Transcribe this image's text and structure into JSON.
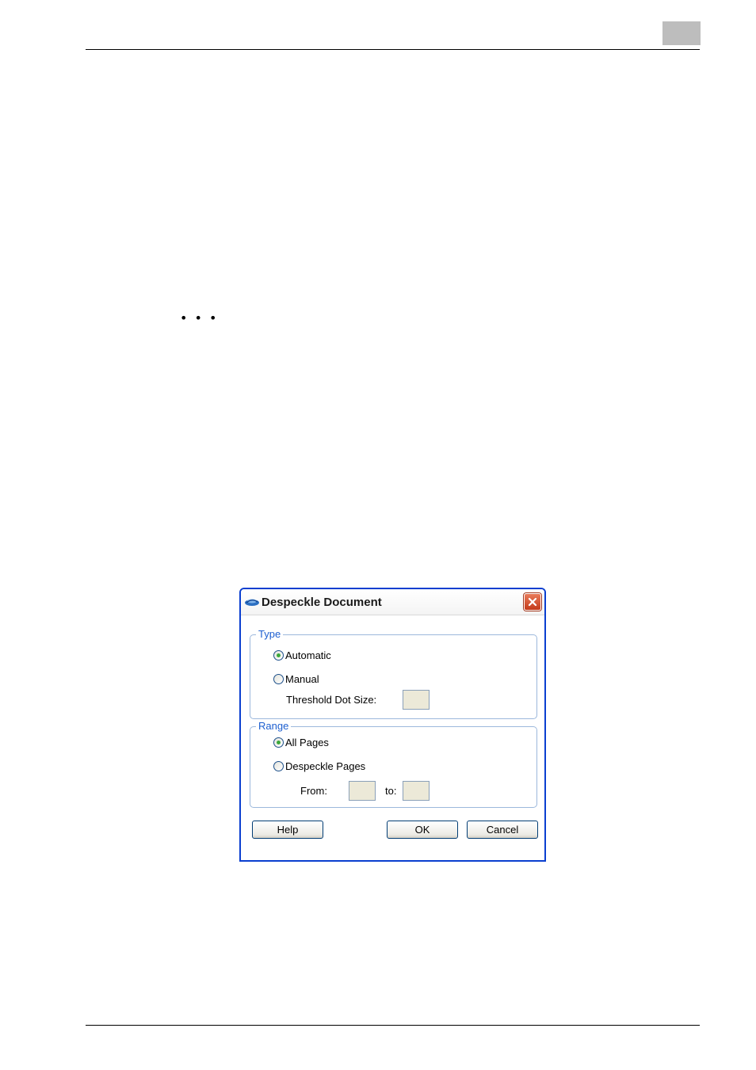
{
  "page": {
    "ellipsis": "• • •"
  },
  "dialog": {
    "title": "Despeckle Document",
    "close_icon": "close-icon",
    "app_icon": "despeckle-app-icon",
    "type_group": {
      "title": "Type",
      "options": [
        {
          "label": "Automatic",
          "checked": true
        },
        {
          "label": "Manual",
          "checked": false
        }
      ],
      "threshold_label": "Threshold Dot Size:",
      "threshold_value": ""
    },
    "range_group": {
      "title": "Range",
      "options": [
        {
          "label": "All Pages",
          "checked": true
        },
        {
          "label": "Despeckle Pages",
          "checked": false
        }
      ],
      "from_label": "From:",
      "from_value": "",
      "to_label": "to:",
      "to_value": ""
    },
    "buttons": {
      "help": "Help",
      "ok": "OK",
      "cancel": "Cancel"
    }
  },
  "colors": {
    "dialog_border": "#0a3fd0",
    "group_title": "#1d5fd0",
    "radio_dot": "#3ca83c",
    "close_button": "#c43a1a"
  }
}
